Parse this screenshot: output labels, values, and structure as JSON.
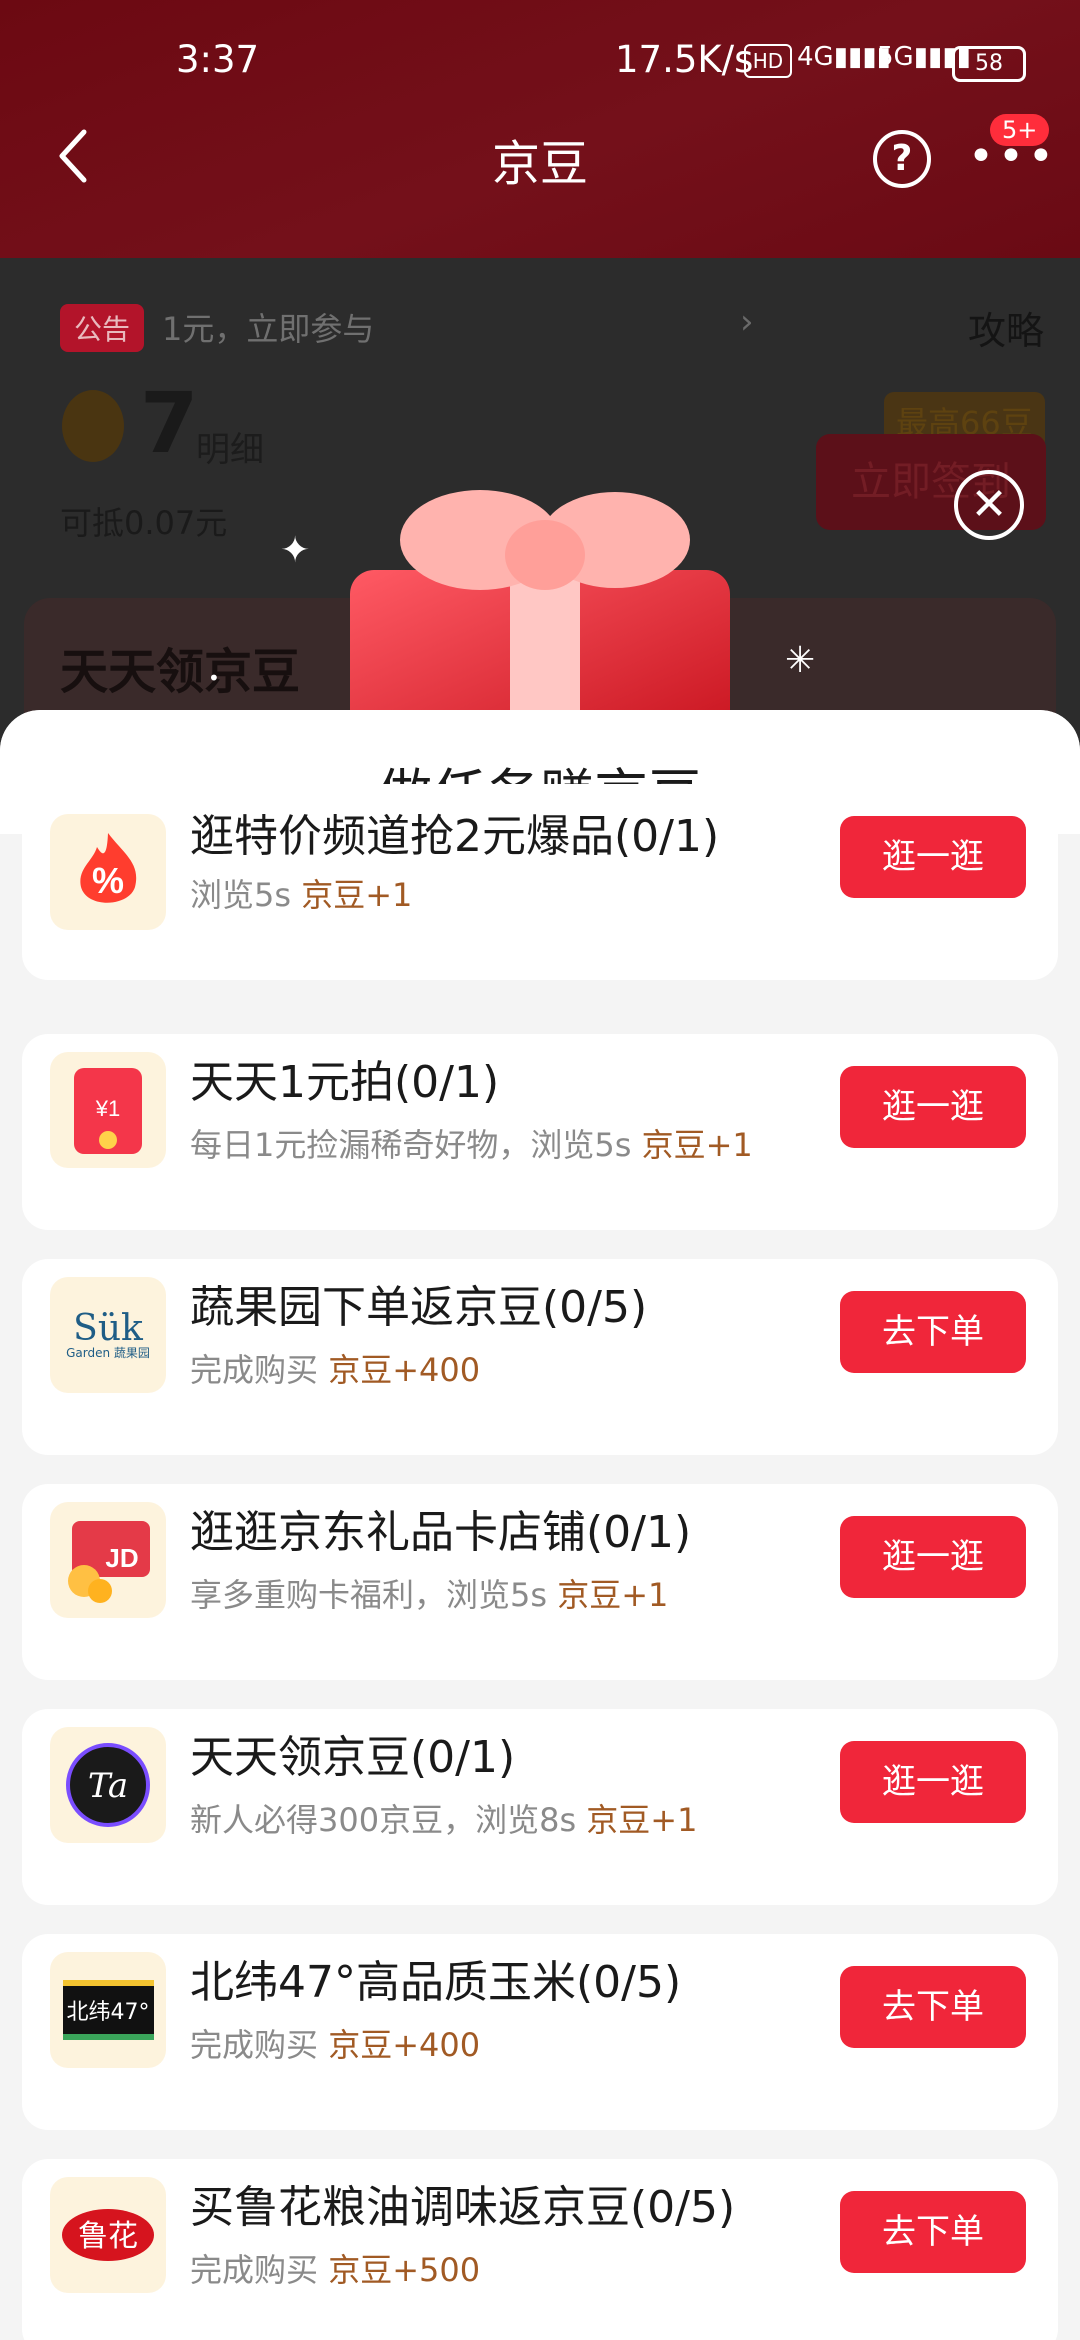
{
  "status_bar": {
    "time": "3:37",
    "speed": "17.5K/s",
    "hd": "HD",
    "net1": "4G",
    "net2": "5G",
    "battery": "58"
  },
  "nav": {
    "title": "京豆",
    "badge": "5+",
    "help_icon": "?"
  },
  "background": {
    "notice_tag": "公告",
    "notice_text": "1元，立即参与",
    "strategy": "攻略",
    "bean_count": "7",
    "detail": "明细",
    "deduct": "可抵0.07元",
    "max_badge": "最高66豆",
    "sign_button": "立即签到",
    "card_title": "天天领京豆"
  },
  "sheet": {
    "title": "做任务赚京豆",
    "tasks": [
      {
        "title": "逛特价频道抢2元爆品(0/1)",
        "desc": "浏览5s",
        "reward": "京豆+1",
        "action": "逛一逛",
        "icon": "fire-percent-icon"
      },
      {
        "title": "天天1元拍(0/1)",
        "desc": "每日1元捡漏稀奇好物，浏览5s",
        "reward": "京豆+1",
        "action": "逛一逛",
        "icon": "red-envelope-icon"
      },
      {
        "title": "蔬果园下单返京豆(0/5)",
        "desc": "完成购买",
        "reward": "京豆+400",
        "action": "去下单",
        "icon": "sukgarden-logo"
      },
      {
        "title": "逛逛京东礼品卡店铺(0/1)",
        "desc": "享多重购卡福利，浏览5s",
        "reward": "京豆+1",
        "action": "逛一逛",
        "icon": "jd-giftcard-icon"
      },
      {
        "title": "天天领京豆(0/1)",
        "desc": "新人必得300京豆，浏览8s",
        "reward": "京豆+1",
        "action": "逛一逛",
        "icon": "ta-logo"
      },
      {
        "title": "北纬47°高品质玉米(0/5)",
        "desc": "完成购买",
        "reward": "京豆+400",
        "action": "去下单",
        "icon": "beiwei47-logo"
      },
      {
        "title": "买鲁花粮油调味返京豆(0/5)",
        "desc": "完成购买",
        "reward": "京豆+500",
        "action": "去下单",
        "icon": "luhua-logo"
      }
    ],
    "icon_texts": {
      "sukgarden": "Sük",
      "sukgarden_sub": "Garden 蔬果园",
      "beiwei": "北纬47°",
      "luhua": "鲁花",
      "ta": "Ta",
      "jd": "JD",
      "envelope": "¥1"
    }
  }
}
